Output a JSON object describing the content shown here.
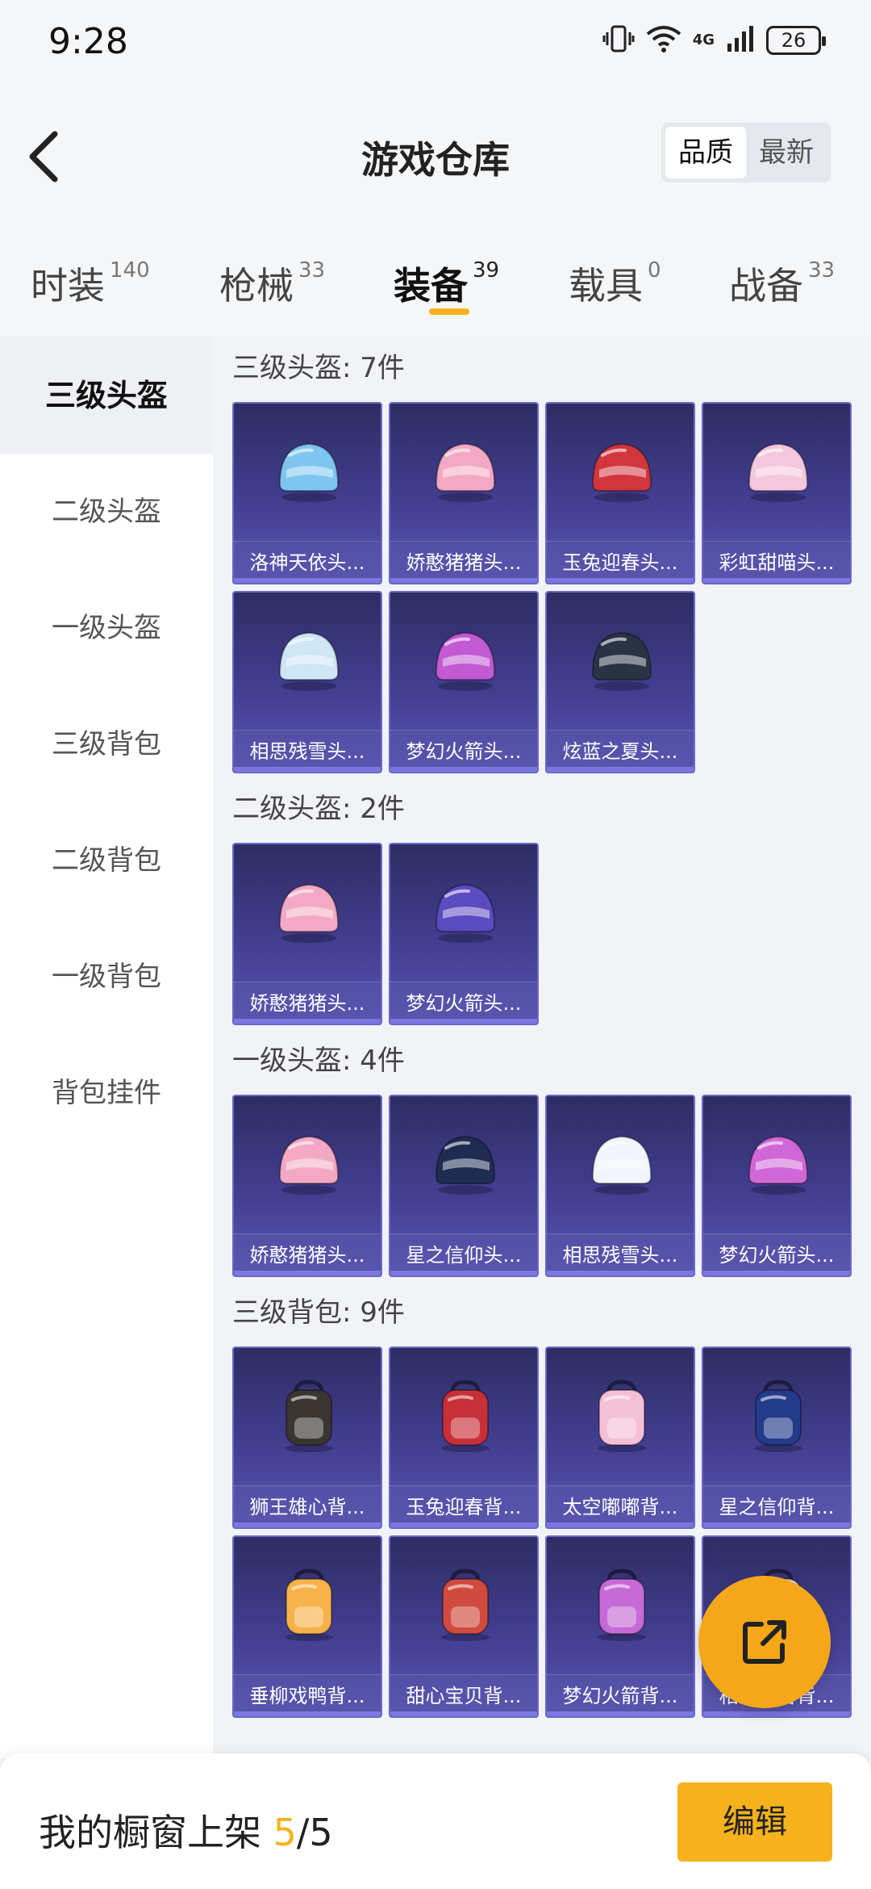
{
  "status_bar": {
    "time": "9:28",
    "battery": "26",
    "network": "4G"
  },
  "header": {
    "title": "游戏仓库",
    "sort_options": [
      "品质",
      "最新"
    ],
    "sort_selected": "品质"
  },
  "tabs": [
    {
      "label": "时装",
      "count": "140"
    },
    {
      "label": "枪械",
      "count": "33"
    },
    {
      "label": "装备",
      "count": "39"
    },
    {
      "label": "载具",
      "count": "0"
    },
    {
      "label": "战备",
      "count": "33"
    }
  ],
  "active_tab": "装备",
  "sidebar": {
    "items": [
      "三级头盔",
      "二级头盔",
      "一级头盔",
      "三级背包",
      "二级背包",
      "一级背包",
      "背包挂件"
    ],
    "active": "三级头盔"
  },
  "sections": [
    {
      "title": "三级头盔: 7件",
      "items": [
        {
          "name": "洛神天依头...",
          "icon": "helmet-icon",
          "color": "#7ec6f0"
        },
        {
          "name": "娇憨猪猪头...",
          "icon": "helmet-icon",
          "color": "#f3a9c4"
        },
        {
          "name": "玉兔迎春头...",
          "icon": "helmet-icon",
          "color": "#d0363c"
        },
        {
          "name": "彩虹甜喵头...",
          "icon": "helmet-icon",
          "color": "#f4c7dd"
        },
        {
          "name": "相思残雪头...",
          "icon": "helmet-icon",
          "color": "#cfe6f6"
        },
        {
          "name": "梦幻火箭头...",
          "icon": "helmet-icon",
          "color": "#c25ad4"
        },
        {
          "name": "炫蓝之夏头...",
          "icon": "helmet-icon",
          "color": "#2a3344"
        }
      ]
    },
    {
      "title": "二级头盔: 2件",
      "items": [
        {
          "name": "娇憨猪猪头...",
          "icon": "helmet-icon",
          "color": "#f3a9c4"
        },
        {
          "name": "梦幻火箭头...",
          "icon": "helmet-icon",
          "color": "#5b4ac0"
        }
      ]
    },
    {
      "title": "一级头盔: 4件",
      "items": [
        {
          "name": "娇憨猪猪头...",
          "icon": "helmet-icon",
          "color": "#f3a9c4"
        },
        {
          "name": "星之信仰头...",
          "icon": "helmet-icon",
          "color": "#1f2c52"
        },
        {
          "name": "相思残雪头...",
          "icon": "helmet-icon",
          "color": "#f2f5fb"
        },
        {
          "name": "梦幻火箭头...",
          "icon": "helmet-icon",
          "color": "#d067d8"
        }
      ]
    },
    {
      "title": "三级背包: 9件",
      "items": [
        {
          "name": "狮王雄心背...",
          "icon": "backpack-icon",
          "color": "#3a3530"
        },
        {
          "name": "玉兔迎春背...",
          "icon": "backpack-icon",
          "color": "#c73038"
        },
        {
          "name": "太空嘟嘟背...",
          "icon": "backpack-icon",
          "color": "#f5c0d6"
        },
        {
          "name": "星之信仰背...",
          "icon": "backpack-icon",
          "color": "#243a8a"
        },
        {
          "name": "垂柳戏鸭背...",
          "icon": "backpack-icon",
          "color": "#f7b24a"
        },
        {
          "name": "甜心宝贝背...",
          "icon": "backpack-icon",
          "color": "#d04a3e"
        },
        {
          "name": "梦幻火箭背...",
          "icon": "backpack-icon",
          "color": "#c56ad6"
        },
        {
          "name": "相思残雪背...",
          "icon": "backpack-icon",
          "color": "#d9e6f4"
        }
      ]
    }
  ],
  "footer": {
    "label": "我的橱窗上架",
    "current": "5",
    "separator": "/",
    "total": "5",
    "edit_label": "编辑"
  },
  "accent_color": "#f5b21c"
}
